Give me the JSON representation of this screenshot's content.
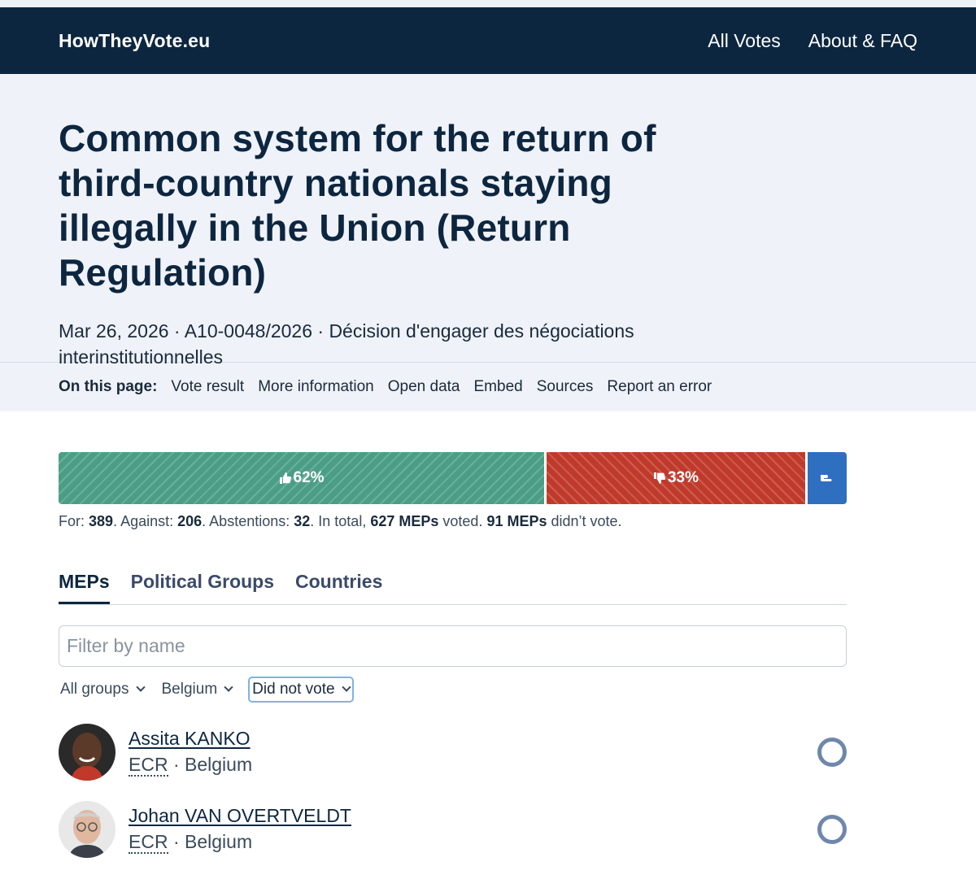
{
  "nav": {
    "brand": "HowTheyVote.eu",
    "links": [
      "All Votes",
      "About & FAQ"
    ]
  },
  "hero": {
    "title": "Common system for the return of third-country nationals staying illegally in the Union (Return Regulation)",
    "meta": "Mar 26, 2026 · A10-0048/2026 · Décision d'engager des négociations interinstitutionnelles"
  },
  "onpage": {
    "label": "On this page:",
    "links": [
      "Vote result",
      "More information",
      "Open data",
      "Embed",
      "Sources",
      "Report an error"
    ]
  },
  "vote": {
    "for_pct": 62,
    "against_pct": 33,
    "abstention_pct": 5,
    "for_label": "62%",
    "against_label": "33%",
    "summary": {
      "for_label": "For: ",
      "for": "389",
      "against_label": ". Against: ",
      "against": "206",
      "abst_label": ". Abstentions: ",
      "abst": "32",
      "total_label": ". In total, ",
      "total": "627 MEPs",
      "voted_label": " voted. ",
      "didnt": "91 MEPs",
      "didnt_label": " didn’t vote."
    },
    "colors": {
      "for": "#4b9e86",
      "against": "#c03a2b",
      "abstention": "#2f6fc0"
    }
  },
  "tabs": [
    "MEPs",
    "Political Groups",
    "Countries"
  ],
  "filter": {
    "placeholder": "Filter by name",
    "value": ""
  },
  "selects": {
    "group": "All groups",
    "country": "Belgium",
    "position": "Did not vote"
  },
  "meps": [
    {
      "name": "Assita KANKO",
      "group": "ECR",
      "country": "Belgium"
    },
    {
      "name": "Johan VAN OVERTVELDT",
      "group": "ECR",
      "country": "Belgium"
    }
  ]
}
